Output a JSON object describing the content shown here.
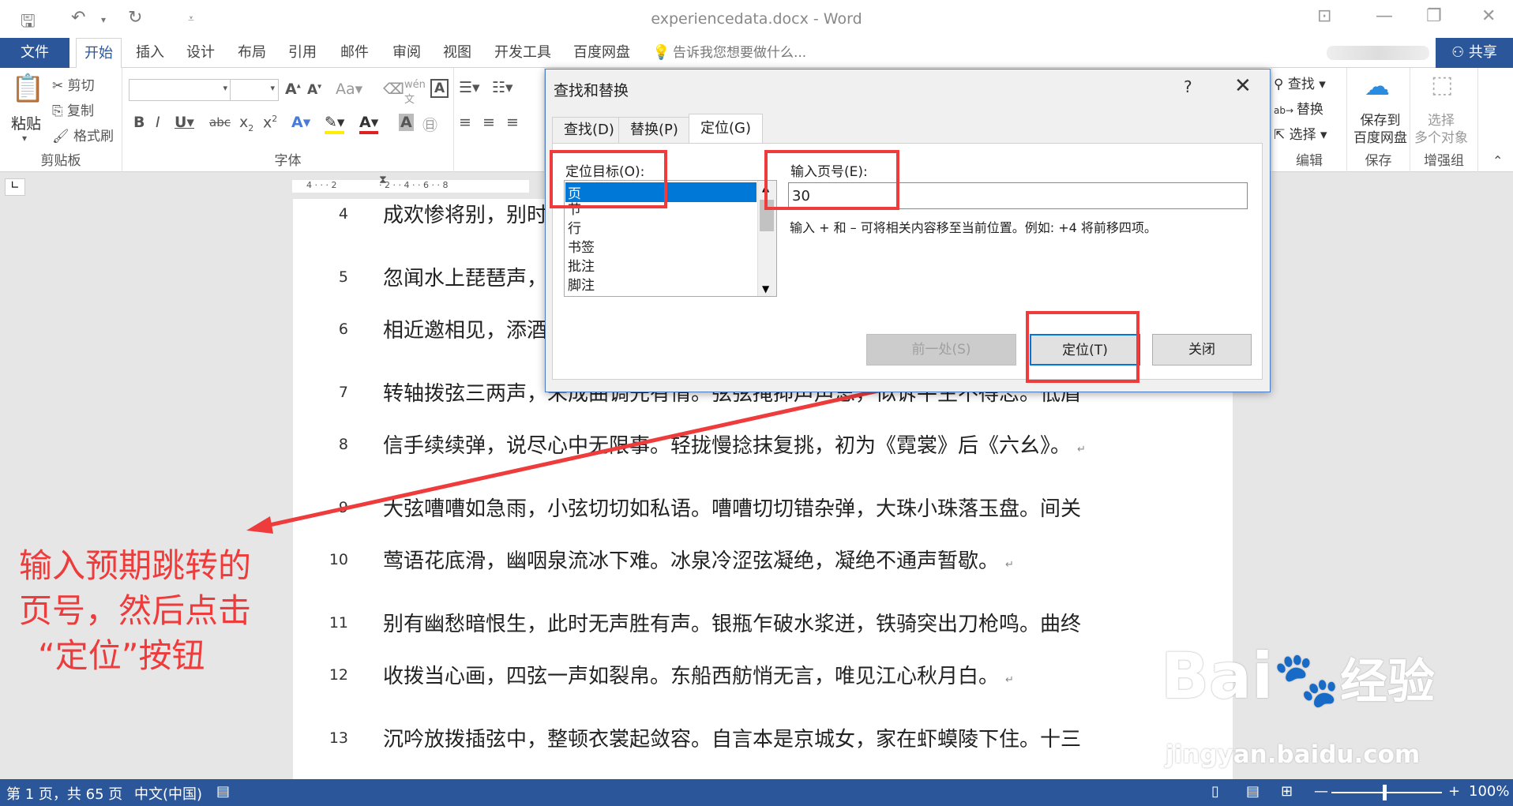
{
  "window": {
    "title": "experiencedata.docx - Word"
  },
  "tabs": {
    "file": "文件",
    "items": [
      "开始",
      "插入",
      "设计",
      "布局",
      "引用",
      "邮件",
      "审阅",
      "视图",
      "开发工具",
      "百度网盘"
    ],
    "tell_me": "告诉我您想要做什么...",
    "share": "共享"
  },
  "ribbon": {
    "clipboard": {
      "paste": "粘贴",
      "cut": "剪切",
      "copy": "复制",
      "format_painter": "格式刷",
      "label": "剪贴板"
    },
    "font": {
      "label": "字体"
    },
    "editing": {
      "find": "查找",
      "replace": "替换",
      "select": "选择",
      "label": "编辑"
    },
    "save": {
      "btn_line1": "保存到",
      "btn_line2": "百度网盘",
      "label": "保存"
    },
    "enhance": {
      "btn_line1": "选择",
      "btn_line2": "多个对象",
      "label": "增强组"
    }
  },
  "document": {
    "lines": [
      {
        "num": "4",
        "text": "成欢惨将别，别时",
        "mark": ""
      },
      {
        "num": "5",
        "text": "忽闻水上琵琶声，",
        "mark": ""
      },
      {
        "num": "6",
        "text": "相近邀相见，添酒",
        "mark": ""
      },
      {
        "num": "7",
        "text": "转轴拨弦三两声，未成曲调先有情。弦弦掩抑声声思，似诉平生不得志。低眉",
        "mark": ""
      },
      {
        "num": "8",
        "text": "信手续续弹，说尽心中无限事。轻拢慢捻抹复挑，初为《霓裳》后《六幺》。",
        "mark": "↵"
      },
      {
        "num": "9",
        "text": "大弦嘈嘈如急雨，小弦切切如私语。嘈嘈切切错杂弹，大珠小珠落玉盘。间关",
        "mark": ""
      },
      {
        "num": "10",
        "text": "莺语花底滑，幽咽泉流冰下难。冰泉冷涩弦凝绝，凝绝不通声暂歇。",
        "mark": "↵"
      },
      {
        "num": "11",
        "text": "别有幽愁暗恨生，此时无声胜有声。银瓶乍破水浆迸，铁骑突出刀枪鸣。曲终",
        "mark": ""
      },
      {
        "num": "12",
        "text": "收拨当心画，四弦一声如裂帛。东船西舫悄无言，唯见江心秋月白。",
        "mark": "↵"
      },
      {
        "num": "13",
        "text": "沉吟放拨插弦中，整顿衣裳起敛容。自言本是京城女，家在虾蟆陵下住。十三",
        "mark": ""
      }
    ]
  },
  "dialog": {
    "title": "查找和替换",
    "help": "?",
    "close": "✕",
    "tabs": [
      "查找(D)",
      "替换(P)",
      "定位(G)"
    ],
    "target_label": "定位目标(O):",
    "targets": [
      "页",
      "节",
      "行",
      "书签",
      "批注",
      "脚注"
    ],
    "selected_target": "页",
    "page_label": "输入页号(E):",
    "page_value": "30",
    "hint": "输入 + 和 – 可将相关内容移至当前位置。例如: +4 将前移四项。",
    "prev_button": "前一处(S)",
    "goto_button": "定位(T)",
    "close_button": "关闭"
  },
  "annotation": {
    "line1": "输入预期跳转的",
    "line2": "页号，然后点击",
    "line3": "“定位”按钮"
  },
  "status": {
    "page": "第 1 页，共 65 页",
    "lang": "中文(中国)",
    "zoom": "100%"
  },
  "watermark": {
    "brand": "Bai",
    "brand2": "经验",
    "url": "jingyan.baidu.com"
  },
  "colors": {
    "accent": "#2b579a",
    "highlight": "#ee3b3b",
    "selection": "#0078d7"
  }
}
